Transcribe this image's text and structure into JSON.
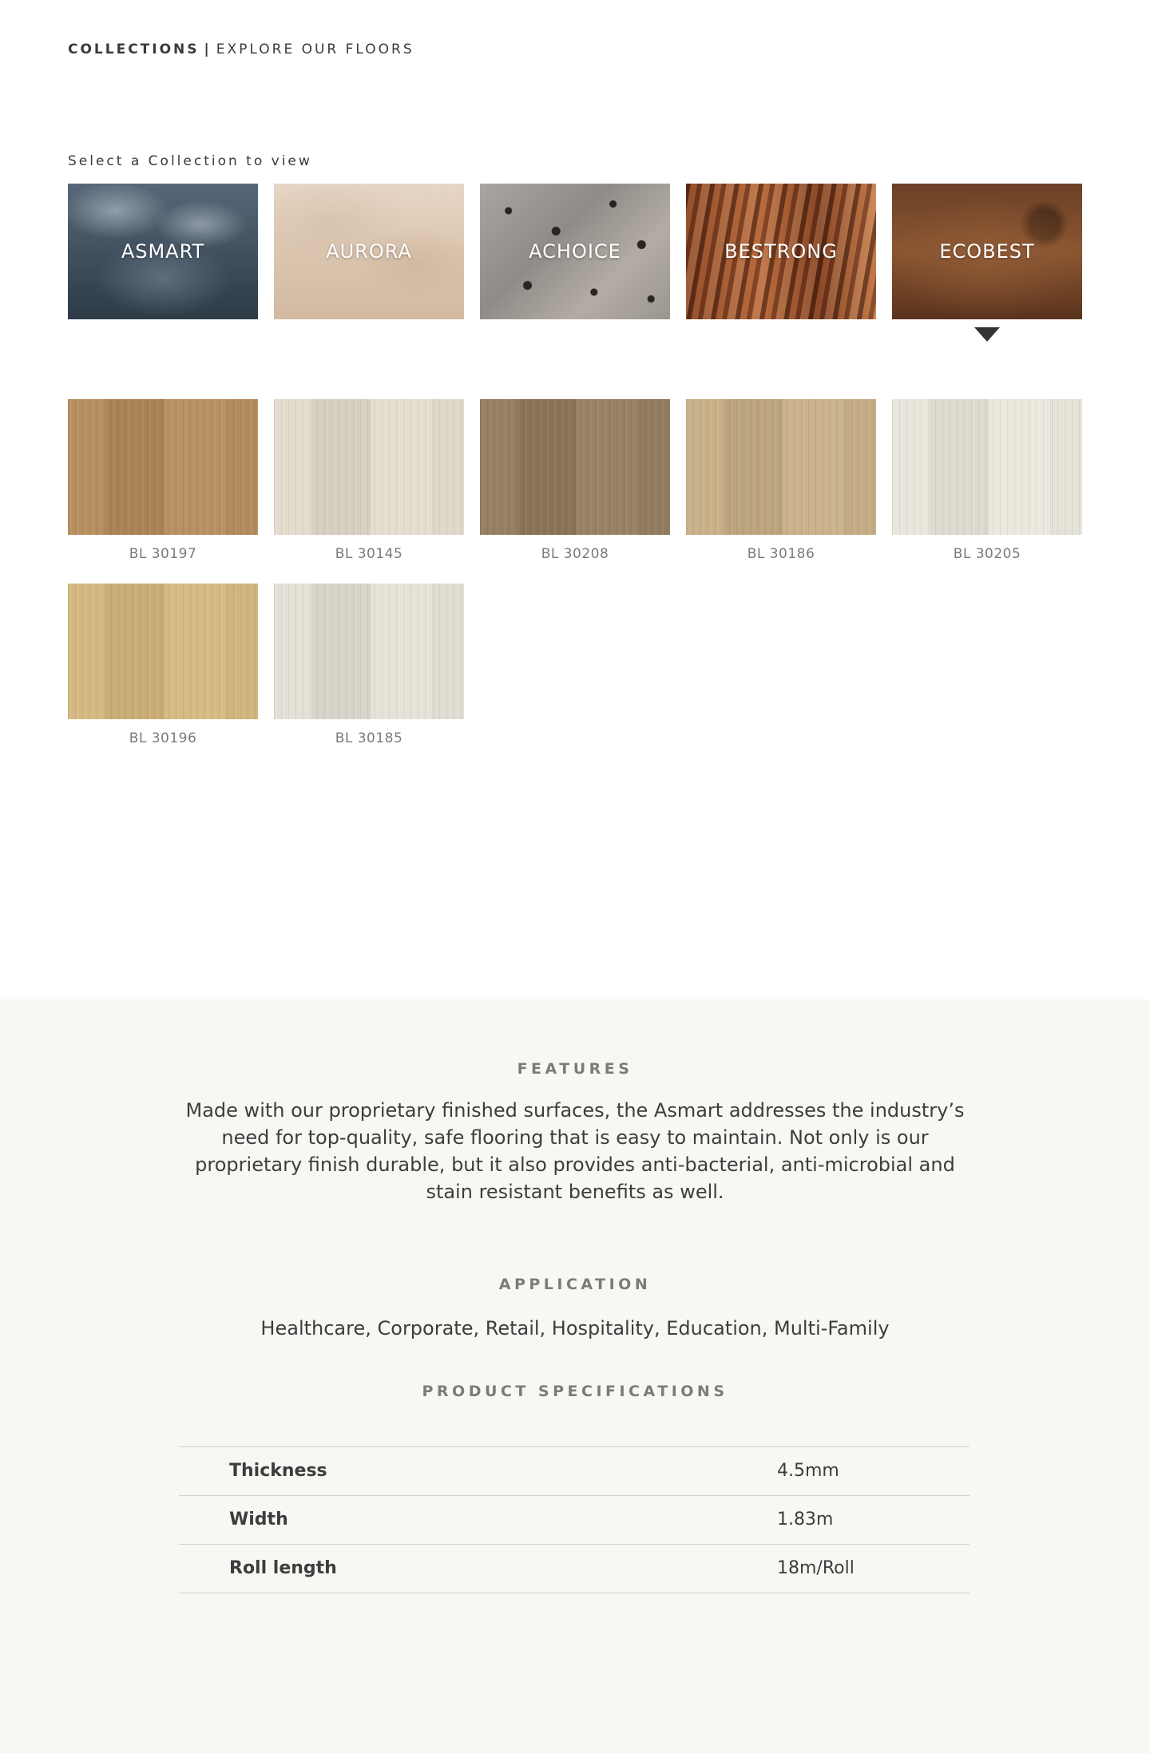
{
  "breadcrumb": {
    "primary": "COLLECTIONS",
    "separator": "|",
    "secondary": "EXPLORE OUR FLOORS"
  },
  "select_label": "Select a Collection to view",
  "collections": [
    {
      "name": "ASMART",
      "icon": "cloud-texture"
    },
    {
      "name": "AURORA",
      "icon": "tree-mist-texture"
    },
    {
      "name": "ACHOICE",
      "icon": "bark-texture"
    },
    {
      "name": "BESTRONG",
      "icon": "wood-grain-texture"
    },
    {
      "name": "ECOBEST",
      "icon": "tree-stump-texture"
    }
  ],
  "selected_collection": "ECOBEST",
  "swatches": [
    {
      "code": "BL 30197",
      "color": "#b0895a"
    },
    {
      "code": "BL 30145",
      "color": "#ddd6c8"
    },
    {
      "code": "BL 30208",
      "color": "#8f7a5c"
    },
    {
      "code": "BL 30186",
      "color": "#c2ab83"
    },
    {
      "code": "BL 30205",
      "color": "#e3e0d6"
    },
    {
      "code": "BL 30196",
      "color": "#cfb27c"
    },
    {
      "code": "BL 30185",
      "color": "#dedad0"
    }
  ],
  "features": {
    "title": "FEATURES",
    "text": "Made with our proprietary finished surfaces, the Asmart addresses the industry’s need for top-quality, safe flooring that is easy to maintain. Not only is our proprietary finish durable, but it also provides anti-bacterial, anti-microbial and stain resistant benefits as well."
  },
  "application": {
    "title": "APPLICATION",
    "text": "Healthcare, Corporate, Retail, Hospitality, Education, Multi-Family"
  },
  "specs": {
    "title": "PRODUCT SPECIFICATIONS",
    "rows": [
      {
        "label": "Thickness",
        "value": "4.5mm"
      },
      {
        "label": "Width",
        "value": "1.83m"
      },
      {
        "label": "Roll length",
        "value": "18m/Roll"
      }
    ]
  }
}
